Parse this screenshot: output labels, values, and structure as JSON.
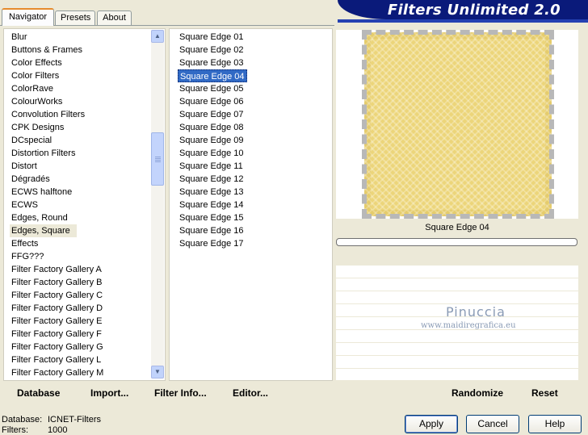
{
  "banner": {
    "title": "Filters Unlimited 2.0"
  },
  "tabs": [
    {
      "label": "Navigator",
      "active": true
    },
    {
      "label": "Presets",
      "active": false
    },
    {
      "label": "About",
      "active": false
    }
  ],
  "categories": [
    "Blur",
    "Buttons & Frames",
    "Color Effects",
    "Color Filters",
    "ColorRave",
    "ColourWorks",
    "Convolution Filters",
    "CPK Designs",
    "DCspecial",
    "Distortion Filters",
    "Distort",
    "Dégradés",
    "ECWS halftone",
    "ECWS",
    "Edges, Round",
    "Edges, Square",
    "Effects",
    "FFG???",
    "Filter Factory Gallery A",
    "Filter Factory Gallery B",
    "Filter Factory Gallery C",
    "Filter Factory Gallery D",
    "Filter Factory Gallery E",
    "Filter Factory Gallery F",
    "Filter Factory Gallery G",
    "Filter Factory Gallery L",
    "Filter Factory Gallery M"
  ],
  "selected_category": "Edges, Square",
  "filters": [
    "Square Edge 01",
    "Square Edge 02",
    "Square Edge 03",
    "Square Edge 04",
    "Square Edge 05",
    "Square Edge 06",
    "Square Edge 07",
    "Square Edge 08",
    "Square Edge 09",
    "Square Edge 10",
    "Square Edge 11",
    "Square Edge 12",
    "Square Edge 13",
    "Square Edge 14",
    "Square Edge 15",
    "Square Edge 16",
    "Square Edge 17"
  ],
  "selected_filter": "Square Edge 04",
  "preview": {
    "filter_name": "Square Edge 04",
    "watermark_name": "Pinuccia",
    "watermark_url": "www.maidiregrafica.eu",
    "stamp_color": "#e5cc6c"
  },
  "links": {
    "database": "Database",
    "import": "Import...",
    "filter_info": "Filter Info...",
    "editor": "Editor...",
    "randomize": "Randomize",
    "reset": "Reset"
  },
  "status": {
    "database_label": "Database:",
    "database_value": "ICNET-Filters",
    "filters_label": "Filters:",
    "filters_value": "1000"
  },
  "buttons": {
    "apply": "Apply",
    "cancel": "Cancel",
    "help": "Help"
  }
}
